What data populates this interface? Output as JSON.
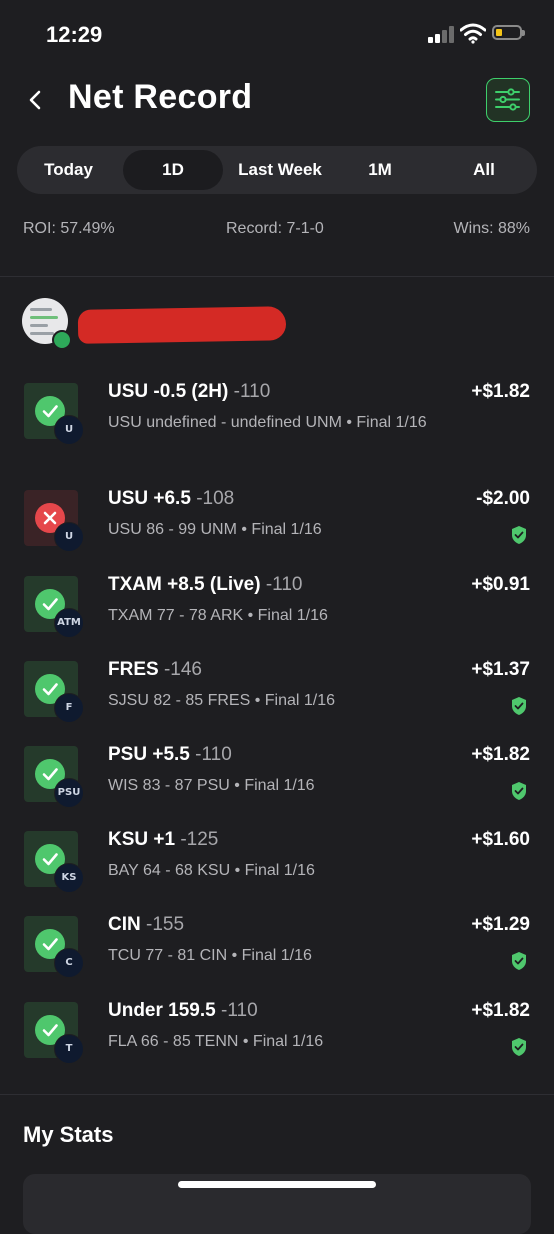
{
  "status_bar": {
    "time": "12:29"
  },
  "header": {
    "title": "Net Record"
  },
  "segments": [
    "Today",
    "1D",
    "Last Week",
    "1M",
    "All"
  ],
  "active_segment": "1D",
  "summary": {
    "roi": "ROI: 57.49%",
    "record": "Record: 7-1-0",
    "wins": "Wins: 88%"
  },
  "bets": [
    {
      "pick": "USU -0.5 (2H)",
      "odds": "-110",
      "detail": "USU undefined - undefined UNM • Final 1/16",
      "amount": "+$1.82",
      "result": "win",
      "team_logo": "U",
      "verified": false
    },
    {
      "pick": "USU +6.5",
      "odds": "-108",
      "detail": "USU 86 - 99 UNM • Final 1/16",
      "amount": "-$2.00",
      "result": "loss",
      "team_logo": "U",
      "verified": true
    },
    {
      "pick": "TXAM +8.5 (Live)",
      "odds": "-110",
      "detail": "TXAM 77 - 78 ARK • Final 1/16",
      "amount": "+$0.91",
      "result": "win",
      "team_logo": "ATM",
      "verified": false
    },
    {
      "pick": "FRES",
      "odds": "-146",
      "detail": "SJSU 82 - 85 FRES • Final 1/16",
      "amount": "+$1.37",
      "result": "win",
      "team_logo": "F",
      "verified": true
    },
    {
      "pick": "PSU +5.5",
      "odds": "-110",
      "detail": "WIS 83 - 87 PSU • Final 1/16",
      "amount": "+$1.82",
      "result": "win",
      "team_logo": "PSU",
      "verified": true
    },
    {
      "pick": "KSU +1",
      "odds": "-125",
      "detail": "BAY 64 - 68 KSU • Final 1/16",
      "amount": "+$1.60",
      "result": "win",
      "team_logo": "KS",
      "verified": false
    },
    {
      "pick": "CIN",
      "odds": "-155",
      "detail": "TCU 77 - 81 CIN • Final 1/16",
      "amount": "+$1.29",
      "result": "win",
      "team_logo": "C",
      "verified": true
    },
    {
      "pick": "Under 159.5",
      "odds": "-110",
      "detail": "FLA 66 - 85 TENN • Final 1/16",
      "amount": "+$1.82",
      "result": "win",
      "team_logo": "T",
      "verified": true
    }
  ],
  "section": {
    "my_stats": "My Stats"
  },
  "colors": {
    "win": "#4fc76d",
    "loss": "#e5474b",
    "accent": "#3ecf6b",
    "background": "#1e1e21"
  },
  "icons": [
    "back-chevron-icon",
    "filter-sliders-icon",
    "checkmark-icon",
    "x-icon",
    "shield-check-icon",
    "signal-icon",
    "wifi-icon",
    "battery-icon"
  ]
}
